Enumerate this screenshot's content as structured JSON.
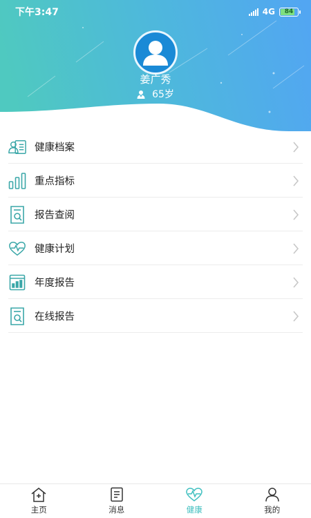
{
  "status_bar": {
    "time": "下午3:47",
    "network": "4G",
    "battery": "84",
    "battery_level": 0.84
  },
  "profile": {
    "name": "姜广秀",
    "age": "65岁",
    "avatar_color": "#1a8ad6"
  },
  "menu": {
    "items": [
      {
        "label": "健康档案",
        "icon": "health-record-icon"
      },
      {
        "label": "重点指标",
        "icon": "bar-chart-icon"
      },
      {
        "label": "报告查阅",
        "icon": "report-search-icon"
      },
      {
        "label": "健康计划",
        "icon": "heart-pulse-icon"
      },
      {
        "label": "年度报告",
        "icon": "annual-report-icon"
      },
      {
        "label": "在线报告",
        "icon": "online-report-icon"
      }
    ]
  },
  "tabbar": {
    "tabs": [
      {
        "label": "主页",
        "icon": "home-icon",
        "active": false
      },
      {
        "label": "消息",
        "icon": "message-icon",
        "active": false
      },
      {
        "label": "健康",
        "icon": "health-icon",
        "active": true
      },
      {
        "label": "我的",
        "icon": "profile-icon",
        "active": false
      }
    ]
  },
  "colors": {
    "accent": "#3fbfbf",
    "icon_teal": "#3aa7a8",
    "header_gradient_start": "#4fc9c0",
    "header_gradient_end": "#52a6f2"
  }
}
